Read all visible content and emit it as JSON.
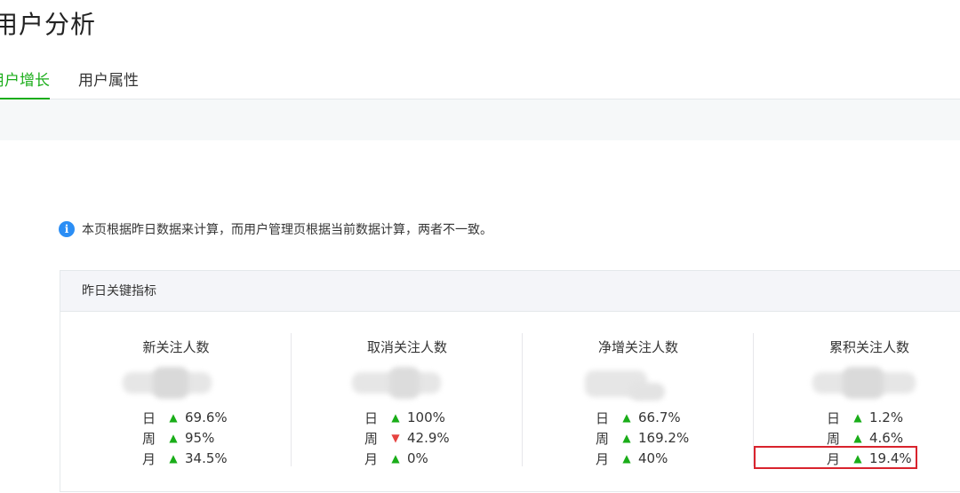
{
  "header": {
    "title": "用户分析"
  },
  "tabs": [
    {
      "label": "用户增长",
      "active": true
    },
    {
      "label": "用户属性",
      "active": false
    }
  ],
  "notice": {
    "icon": "info-icon",
    "text": "本页根据昨日数据来计算，而用户管理页根据当前数据计算，两者不一致。"
  },
  "panel": {
    "title": "昨日关键指标",
    "metrics": [
      {
        "title": "新关注人数",
        "rows": [
          {
            "period": "日",
            "direction": "up",
            "pct": "69.6%"
          },
          {
            "period": "周",
            "direction": "up",
            "pct": "95%"
          },
          {
            "period": "月",
            "direction": "up",
            "pct": "34.5%"
          }
        ]
      },
      {
        "title": "取消关注人数",
        "rows": [
          {
            "period": "日",
            "direction": "up",
            "pct": "100%"
          },
          {
            "period": "周",
            "direction": "down",
            "pct": "42.9%"
          },
          {
            "period": "月",
            "direction": "up",
            "pct": "0%"
          }
        ]
      },
      {
        "title": "净增关注人数",
        "rows": [
          {
            "period": "日",
            "direction": "up",
            "pct": "66.7%"
          },
          {
            "period": "周",
            "direction": "up",
            "pct": "169.2%"
          },
          {
            "period": "月",
            "direction": "up",
            "pct": "40%"
          }
        ]
      },
      {
        "title": "累积关注人数",
        "rows": [
          {
            "period": "日",
            "direction": "up",
            "pct": "1.2%"
          },
          {
            "period": "周",
            "direction": "up",
            "pct": "4.6%"
          },
          {
            "period": "月",
            "direction": "up",
            "pct": "19.4%"
          }
        ]
      }
    ]
  },
  "colors": {
    "accent": "#1aad19",
    "down": "#e64340",
    "info": "#2b8ef5",
    "highlight": "#d9232d"
  }
}
